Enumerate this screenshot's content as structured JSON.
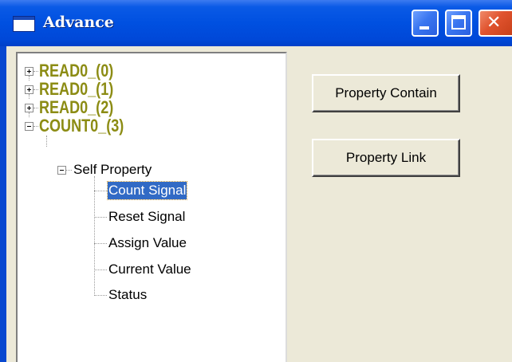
{
  "window": {
    "title": "Advance"
  },
  "tree": {
    "nodes": [
      {
        "label": "READ0_(0)",
        "expander": "plus"
      },
      {
        "label": "READ0_(1)",
        "expander": "plus"
      },
      {
        "label": "READ0_(2)",
        "expander": "plus"
      },
      {
        "label": "COUNT0_(3)",
        "expander": "minus"
      }
    ],
    "sub_group": {
      "label": "Self Property",
      "expander": "minus"
    },
    "leaves": [
      "Count Signal",
      "Reset Signal",
      "Assign Value",
      "Current Value",
      "Status"
    ],
    "selected_leaf": "Count Signal"
  },
  "buttons": {
    "property_contain": "Property Contain",
    "property_link": "Property Link"
  },
  "colors": {
    "titlebar": "#0050e0",
    "node_text": "#8c8c14",
    "selection": "#316ac5",
    "dialog_bg": "#ece9d8"
  }
}
